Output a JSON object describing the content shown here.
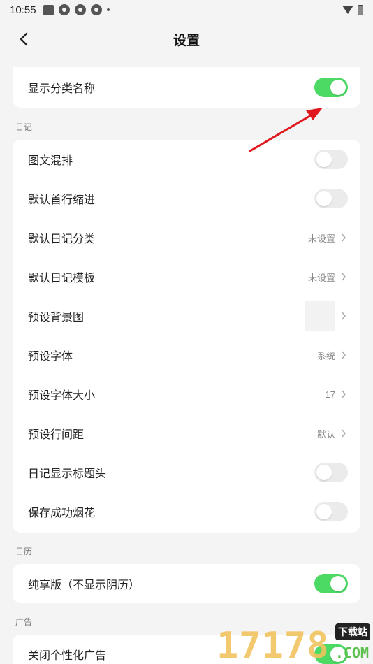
{
  "status_bar": {
    "time": "10:55"
  },
  "header": {
    "title": "设置"
  },
  "top_card": {
    "label": "显示分类名称",
    "toggle_on": true
  },
  "diary_section": {
    "title": "日记",
    "items": [
      {
        "label": "图文混排",
        "type": "toggle",
        "on": false
      },
      {
        "label": "默认首行缩进",
        "type": "toggle",
        "on": false
      },
      {
        "label": "默认日记分类",
        "type": "value",
        "value": "未设置"
      },
      {
        "label": "默认日记模板",
        "type": "value",
        "value": "未设置"
      },
      {
        "label": "预设背景图",
        "type": "image"
      },
      {
        "label": "预设字体",
        "type": "value",
        "value": "系统"
      },
      {
        "label": "预设字体大小",
        "type": "value",
        "value": "17"
      },
      {
        "label": "预设行间距",
        "type": "value",
        "value": "默认"
      },
      {
        "label": "日记显示标题头",
        "type": "toggle",
        "on": false
      },
      {
        "label": "保存成功烟花",
        "type": "toggle",
        "on": false
      }
    ]
  },
  "calendar_section": {
    "title": "日历",
    "items": [
      {
        "label": "纯享版（不显示阴历）",
        "type": "toggle",
        "on": true
      }
    ]
  },
  "ads_section": {
    "title": "广告",
    "items": [
      {
        "label": "关闭个性化广告",
        "type": "toggle",
        "on": true
      }
    ]
  },
  "watermark": {
    "number": "17178",
    "site": "下载站",
    "domain": ".COM"
  },
  "colors": {
    "toggle_on": "#4cd964",
    "arrow": "#e0191f"
  }
}
